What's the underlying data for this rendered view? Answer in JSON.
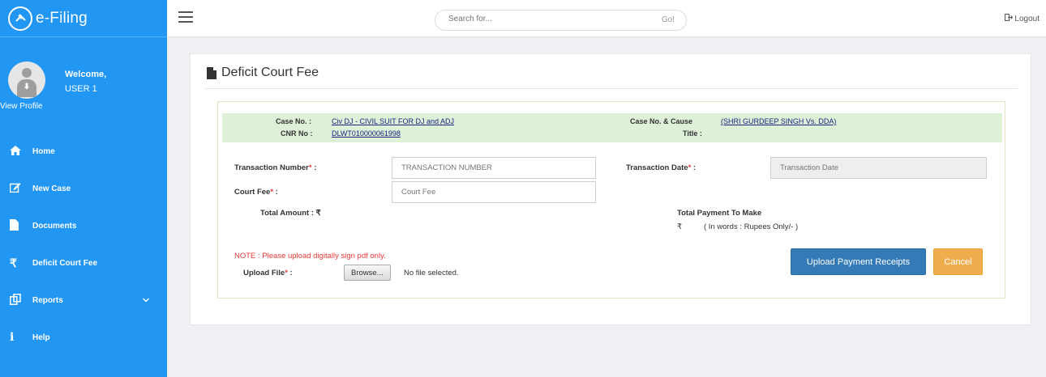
{
  "brand": {
    "title": "e-Filing",
    "logo_icon": "gavel-icon"
  },
  "profile": {
    "welcome": "Welcome,",
    "user": "USER 1",
    "view_profile": "View Profile"
  },
  "sidebar": {
    "items": [
      {
        "label": "Home",
        "icon": "home-icon"
      },
      {
        "label": "New Case",
        "icon": "edit-icon"
      },
      {
        "label": "Documents",
        "icon": "document-icon"
      },
      {
        "label": "Deficit Court Fee",
        "icon": "rupee-icon"
      },
      {
        "label": "Reports",
        "icon": "copy-icon",
        "chevron": "chevron-down-icon"
      },
      {
        "label": "Help",
        "icon": "info-icon"
      }
    ]
  },
  "topbar": {
    "search_placeholder": "Search for...",
    "search_go": "Go!",
    "logout": "Logout"
  },
  "page": {
    "title": "Deficit Court Fee"
  },
  "case_info": {
    "case_no_label": "Case No. :",
    "case_no_value": "Civ DJ - CIVIL SUIT FOR DJ and ADJ",
    "cnr_label": "CNR No :",
    "cnr_value": "DLWT010000061998",
    "cause_label": "Case No. & Cause",
    "cause_value": "(SHRI GURDEEP SINGH Vs. DDA)",
    "title_label": "Title :"
  },
  "form": {
    "transaction_number_label": "Transaction Number",
    "transaction_number_placeholder": "TRANSACTION NUMBER",
    "transaction_date_label": "Transaction Date",
    "transaction_date_placeholder": "Transaction Date",
    "court_fee_label": "Court Fee",
    "court_fee_placeholder": "Court Fee",
    "total_amount_label": "Total Amount : ₹",
    "total_payment_label": "Total Payment To Make",
    "rupee_symbol": "₹",
    "in_words": "( In words : Rupees Only/- )",
    "required_mark": "*",
    "colon": " :"
  },
  "upload": {
    "note": "NOTE : Please upload digitally sign pdf only.",
    "label": "Upload File",
    "browse": "Browse...",
    "no_file": "No file selected."
  },
  "buttons": {
    "upload_receipts": "Upload Payment Receipts",
    "cancel": "Cancel"
  },
  "colors": {
    "sidebar": "#2196f3",
    "case_strip": "#dff0d8",
    "primary": "#337ab7",
    "warning": "#f0ad4e",
    "required": "#e53935"
  }
}
